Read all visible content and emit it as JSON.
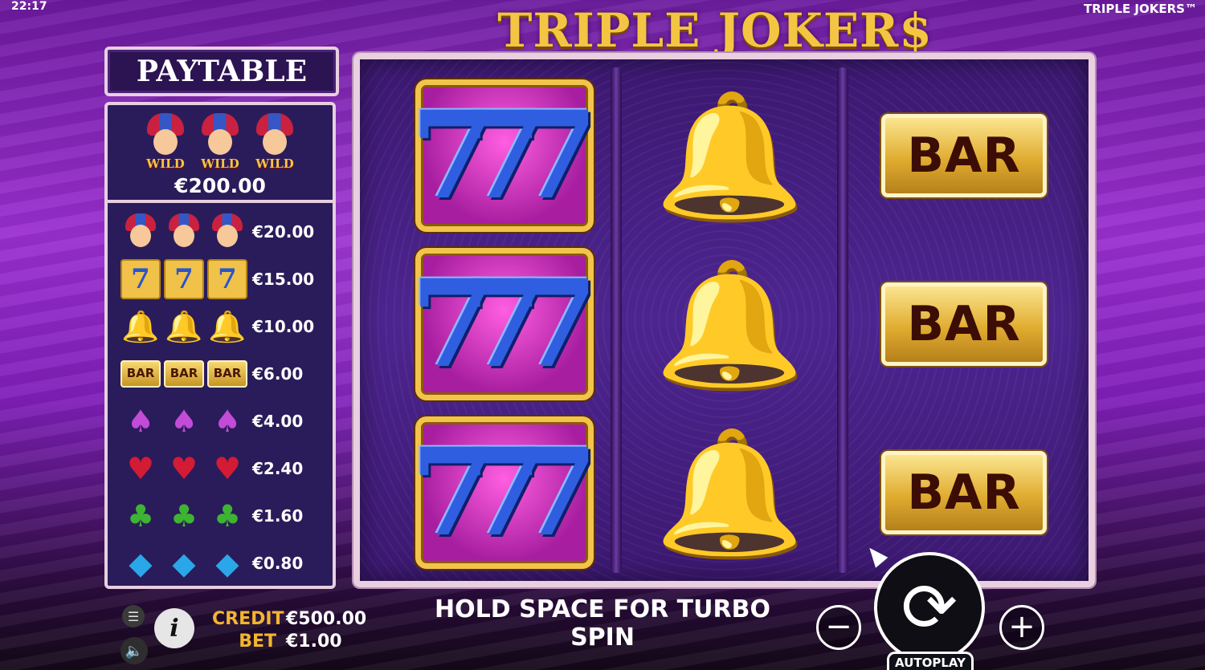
{
  "status_bar": {
    "clock": "22:17",
    "brand": "TRIPLE JOKERS™"
  },
  "game": {
    "title": "TRIPLE JOKER$"
  },
  "paytable": {
    "header": "PAYTABLE",
    "top": {
      "symbol": "joker",
      "label": "WILD",
      "count": 3,
      "payout": "€200.00"
    },
    "rows": [
      {
        "symbol": "joker",
        "icon": "joker-icon",
        "payout": "€20.00"
      },
      {
        "symbol": "seven",
        "icon": "seven-icon",
        "payout": "€15.00"
      },
      {
        "symbol": "bell",
        "icon": "bell-icon",
        "payout": "€10.00"
      },
      {
        "symbol": "bar",
        "icon": "bar-icon",
        "label": "BAR",
        "payout": "€6.00"
      },
      {
        "symbol": "spade",
        "icon": "spade-icon",
        "payout": "€4.00"
      },
      {
        "symbol": "heart",
        "icon": "heart-icon",
        "payout": "€2.40"
      },
      {
        "symbol": "club",
        "icon": "club-icon",
        "payout": "€1.60"
      },
      {
        "symbol": "diamond",
        "icon": "diamond-icon",
        "payout": "€0.80"
      }
    ]
  },
  "reels": [
    [
      "seven",
      "seven",
      "seven"
    ],
    [
      "bell",
      "bell",
      "bell"
    ],
    [
      "bar",
      "bar",
      "bar"
    ]
  ],
  "reel_labels": {
    "bar": "BAR"
  },
  "controls": {
    "turbo_hint": "HOLD SPACE FOR TURBO SPIN",
    "credit_label": "CREDIT",
    "credit_value": "€500.00",
    "bet_label": "BET",
    "bet_value": "€1.00",
    "autoplay_label": "AUTOPLAY",
    "minus_label": "−",
    "plus_label": "+"
  }
}
